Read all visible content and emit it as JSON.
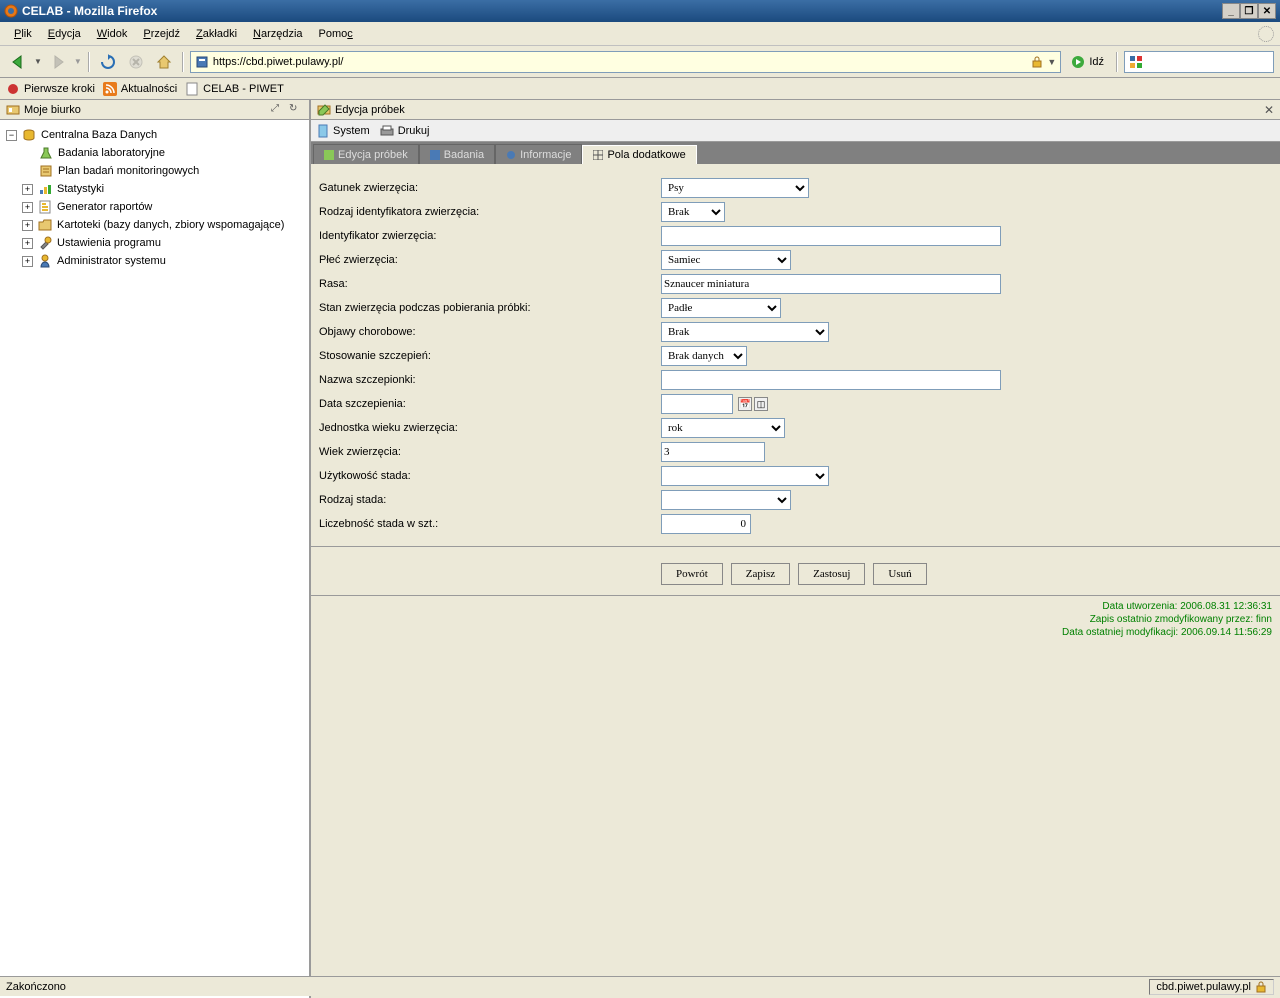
{
  "window": {
    "title": "CELAB - Mozilla Firefox"
  },
  "menubar": {
    "file": "Plik",
    "edit": "Edycja",
    "view": "Widok",
    "go": "Przejdź",
    "bookmarks": "Zakładki",
    "tools": "Narzędzia",
    "help": "Pomoc"
  },
  "navbar": {
    "url": "https://cbd.piwet.pulawy.pl/",
    "go_label": "Idź"
  },
  "bookmarks": {
    "first_steps": "Pierwsze kroki",
    "news": "Aktualności",
    "celab": "CELAB - PIWET"
  },
  "sidebar": {
    "title": "Moje biurko",
    "tree": {
      "root": "Centralna Baza Danych",
      "badania": "Badania laboratoryjne",
      "plan": "Plan badań monitoringowych",
      "statystyki": "Statystyki",
      "generator": "Generator raportów",
      "kartoteki": "Kartoteki (bazy danych, zbiory wspomagające)",
      "ustawienia": "Ustawienia programu",
      "admin": "Administrator systemu"
    }
  },
  "content": {
    "header_title": "Edycja próbek",
    "toolbar": {
      "system": "System",
      "drukuj": "Drukuj"
    },
    "tabs": {
      "edycja": "Edycja próbek",
      "badania": "Badania",
      "informacje": "Informacje",
      "pola": "Pola dodatkowe"
    }
  },
  "form": {
    "labels": {
      "gatunek": "Gatunek zwierzęcia:",
      "rodzaj_id": "Rodzaj identyfikatora zwierzęcia:",
      "identyfikator": "Identyfikator zwierzęcia:",
      "plec": "Płeć zwierzęcia:",
      "rasa": "Rasa:",
      "stan": "Stan zwierzęcia podczas pobierania próbki:",
      "objawy": "Objawy chorobowe:",
      "szczepien": "Stosowanie szczepień:",
      "nazwa_szcz": "Nazwa szczepionki:",
      "data_szcz": "Data szczepienia:",
      "jednostka_wieku": "Jednostka wieku zwierzęcia:",
      "wiek": "Wiek zwierzęcia:",
      "uzytkowosc": "Użytkowość stada:",
      "rodzaj_stada": "Rodzaj stada:",
      "liczebnosc": "Liczebność stada w szt.:"
    },
    "values": {
      "gatunek": "Psy",
      "rodzaj_id": "Brak",
      "identyfikator": "",
      "plec": "Samiec",
      "rasa": "Sznaucer miniatura",
      "stan": "Padłe",
      "objawy": "Brak",
      "szczepien": "Brak danych",
      "nazwa_szcz": "",
      "data_szcz": "",
      "jednostka_wieku": "rok",
      "wiek": "3",
      "uzytkowosc": "",
      "rodzaj_stada": "",
      "liczebnosc": "0"
    },
    "buttons": {
      "powrot": "Powrót",
      "zapisz": "Zapisz",
      "zastosuj": "Zastosuj",
      "usun": "Usuń"
    }
  },
  "meta": {
    "created": "Data utworzenia: 2006.08.31 12:36:31",
    "modified_by": "Zapis ostatnio zmodyfikowany przez: finn",
    "modified_at": "Data ostatniej modyfikacji: 2006.09.14 11:56:29"
  },
  "statusbar": {
    "status": "Zakończono",
    "host": "cbd.piwet.pulawy.pl"
  }
}
